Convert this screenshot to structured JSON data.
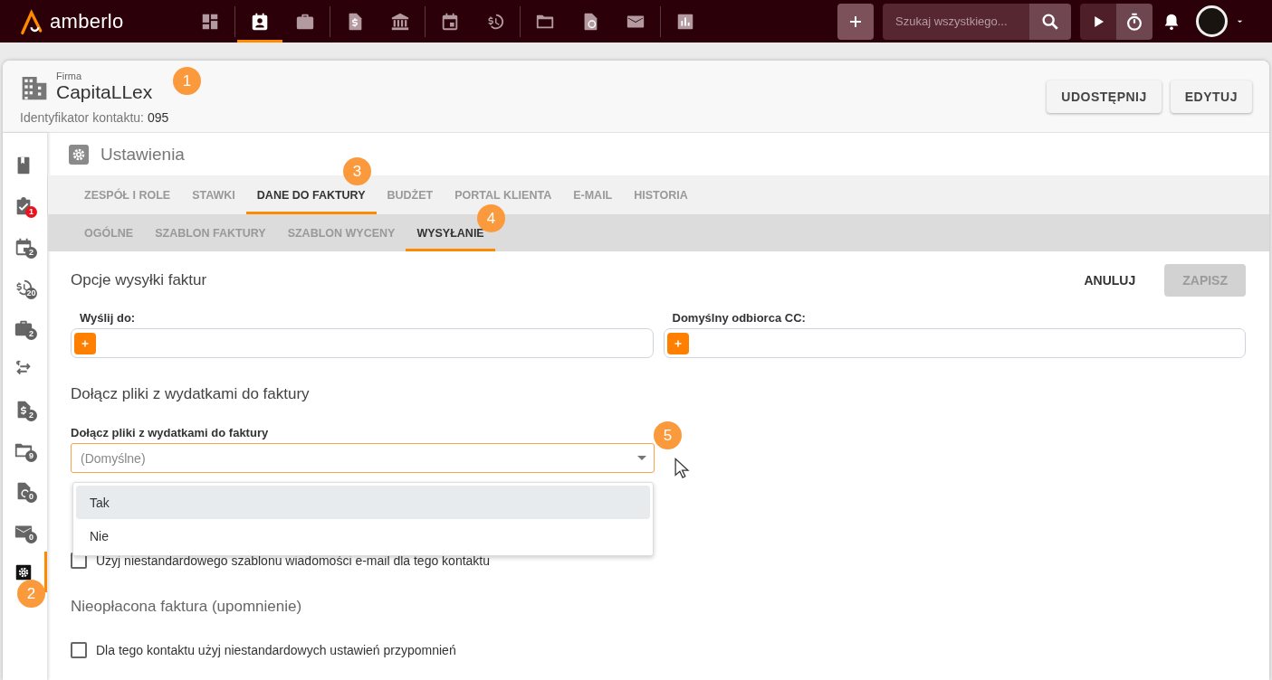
{
  "topbar": {
    "logo": "amberlo",
    "nav": [
      {
        "kind": "dashboard",
        "selected": false,
        "group_end": true
      },
      {
        "kind": "contact",
        "selected": true,
        "group_end": false
      },
      {
        "kind": "briefcase",
        "selected": false,
        "group_end": true
      },
      {
        "kind": "dollar-doc",
        "selected": false,
        "group_end": false
      },
      {
        "kind": "bank",
        "selected": false,
        "group_end": true
      },
      {
        "kind": "calendar",
        "selected": false,
        "group_end": false
      },
      {
        "kind": "history",
        "selected": false,
        "group_end": true
      },
      {
        "kind": "folder",
        "selected": false,
        "group_end": false
      },
      {
        "kind": "certificate",
        "selected": false,
        "group_end": false
      },
      {
        "kind": "mail",
        "selected": false,
        "group_end": true
      },
      {
        "kind": "chart",
        "selected": false,
        "group_end": false
      }
    ],
    "search": {
      "placeholder": "Szukaj wszystkiego..."
    }
  },
  "contact": {
    "type": "Firma",
    "name": "CapitaLLex",
    "id_label": "Identyfikator kontaktu:",
    "id_value": "095",
    "actions": [
      "UDOSTĘPNIJ",
      "EDYTUJ"
    ]
  },
  "sidebar": {
    "items": [
      {
        "kind": "book",
        "selected": false
      },
      {
        "kind": "task",
        "badge": "1",
        "color": "#e8141e",
        "selected": false
      },
      {
        "kind": "calendar",
        "badge": "2",
        "color": "#616161",
        "selected": false
      },
      {
        "kind": "history",
        "badge": "20",
        "color": "#616161",
        "selected": false
      },
      {
        "kind": "briefcase",
        "badge": "2",
        "color": "#616161",
        "selected": false
      },
      {
        "kind": "swap",
        "selected": false
      },
      {
        "kind": "dollar-doc",
        "badge": "2",
        "color": "#616161",
        "selected": false
      },
      {
        "kind": "folder",
        "badge": "9",
        "color": "#616161",
        "selected": false
      },
      {
        "kind": "certificate",
        "badge": "0",
        "color": "#616161",
        "selected": false
      },
      {
        "kind": "mail",
        "badge": "0",
        "color": "#616161",
        "selected": false
      },
      {
        "kind": "gear",
        "selected": true
      }
    ]
  },
  "section": {
    "title": "Ustawienia"
  },
  "tabs": [
    {
      "label": "ZESPÓŁ I ROLE",
      "selected": false
    },
    {
      "label": "STAWKI",
      "selected": false
    },
    {
      "label": "DANE DO FAKTURY",
      "selected": true
    },
    {
      "label": "BUDŻET",
      "selected": false
    },
    {
      "label": "PORTAL KLIENTA",
      "selected": false
    },
    {
      "label": "E-MAIL",
      "selected": false
    },
    {
      "label": "HISTORIA",
      "selected": false
    }
  ],
  "subtabs": [
    {
      "label": "OGÓLNE",
      "selected": false
    },
    {
      "label": "SZABLON FAKTURY",
      "selected": false
    },
    {
      "label": "SZABLON WYCENY",
      "selected": false
    },
    {
      "label": "WYSYŁANIE",
      "selected": true
    }
  ],
  "form": {
    "title": "Opcje wysyłki faktur",
    "buttons": [
      {
        "label": "ANULUJ",
        "disabled": false
      },
      {
        "label": "ZAPISZ",
        "disabled": true
      }
    ],
    "recipients": [
      {
        "label": "Wyślij do:"
      },
      {
        "label": "Domyślny odbiorca CC:"
      }
    ],
    "attach_heading": "Dołącz pliki z wydatkami do faktury",
    "attach_select": {
      "label": "Dołącz pliki z wydatkami do faktury",
      "placeholder": "(Domyślne)",
      "expanded": true,
      "options": [
        {
          "label": "Tak",
          "selected": true
        },
        {
          "label": "Nie",
          "selected": false
        }
      ]
    },
    "email_template": {
      "label": "Użyj niestandardowego szablonu wiadomości e-mail dla tego kontaktu",
      "checked": false
    },
    "reminder_heading": "Nieopłacona faktura (upomnienie)",
    "reminder": {
      "label": "Dla tego kontaktu użyj niestandardowych ustawień przypomnień",
      "checked": false
    }
  },
  "callouts": [
    "1",
    "2",
    "3",
    "4",
    "5"
  ]
}
